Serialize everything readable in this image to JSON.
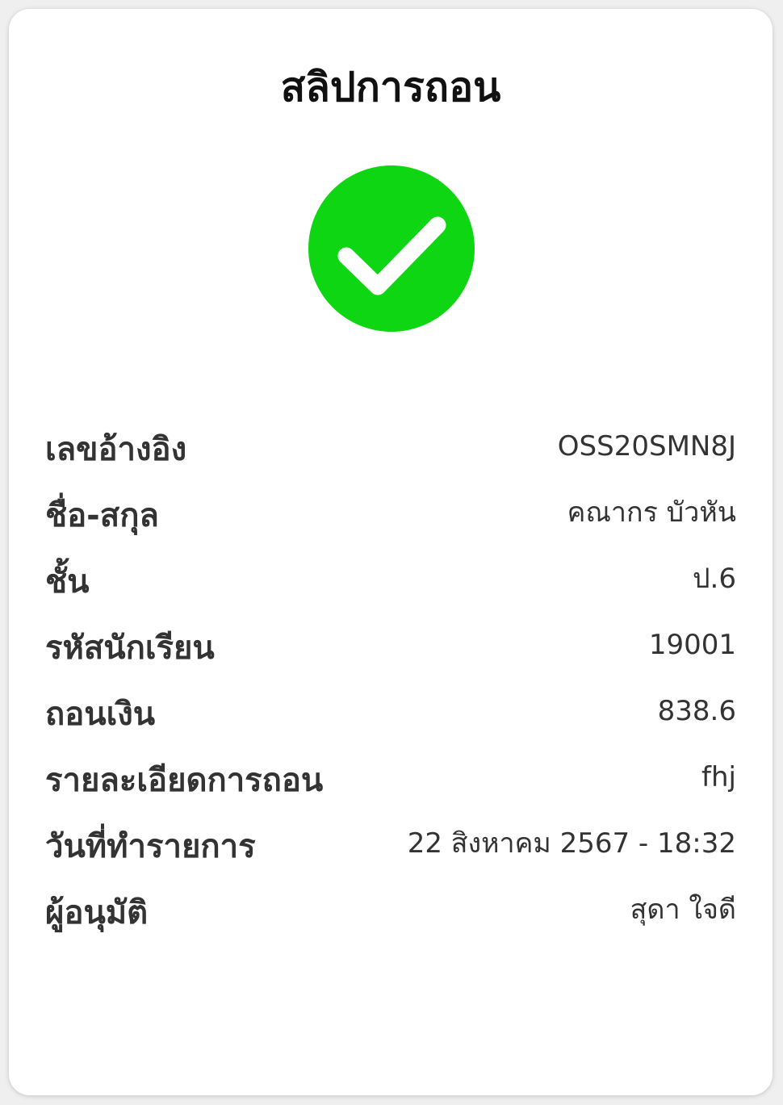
{
  "slip": {
    "title": "สลิปการถอน",
    "status_icon": "check-circle-icon",
    "accent_color": "#0ed612",
    "rows": [
      {
        "label": "เลขอ้างอิง",
        "value": "OSS20SMN8J"
      },
      {
        "label": "ชื่อ-สกุล",
        "value": "คณากร บัวหัน"
      },
      {
        "label": "ชั้น",
        "value": "ป.6"
      },
      {
        "label": "รหัสนักเรียน",
        "value": "19001"
      },
      {
        "label": "ถอนเงิน",
        "value": "838.6"
      },
      {
        "label": "รายละเอียดการถอน",
        "value": "fhj"
      },
      {
        "label": "วันที่ทำรายการ",
        "value": "22 สิงหาคม 2567 - 18:32"
      },
      {
        "label": "ผู้อนุมัติ",
        "value": "สุดา ใจดี"
      }
    ]
  }
}
